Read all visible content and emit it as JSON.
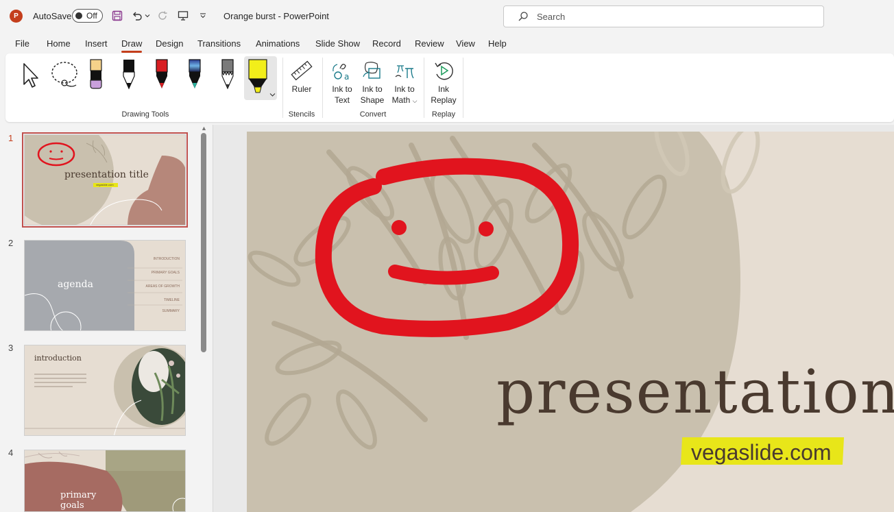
{
  "titlebar": {
    "app_logo": "P",
    "autosave_label": "AutoSave",
    "autosave_state": "Off",
    "doc_title": "Orange burst  -  PowerPoint",
    "search_placeholder": "Search"
  },
  "tabs": [
    "File",
    "Home",
    "Insert",
    "Draw",
    "Design",
    "Transitions",
    "Animations",
    "Slide Show",
    "Record",
    "Review",
    "View",
    "Help"
  ],
  "active_tab": "Draw",
  "ribbon": {
    "groups": {
      "drawing_tools": "Drawing Tools",
      "stencils": "Stencils",
      "convert": "Convert",
      "replay": "Replay"
    },
    "ruler": "Ruler",
    "ink_to_text_1": "Ink to",
    "ink_to_text_2": "Text",
    "ink_to_shape_1": "Ink to",
    "ink_to_shape_2": "Shape",
    "ink_to_math_1": "Ink to",
    "ink_to_math_2": "Math",
    "ink_replay_1": "Ink",
    "ink_replay_2": "Replay"
  },
  "thumbnails": [
    {
      "num": "1",
      "title": "presentation title",
      "sub": "vegaslide.com"
    },
    {
      "num": "2",
      "title": "agenda",
      "items": [
        "INTRODUCTION",
        "PRIMARY GOALS",
        "AREAS OF GROWTH",
        "TIMELINE",
        "SUMMARY"
      ]
    },
    {
      "num": "3",
      "title": "introduction"
    },
    {
      "num": "4",
      "title_1": "primary",
      "title_2": "goals"
    }
  ],
  "slide": {
    "title": "presentation",
    "subtitle": "vegaslide.com"
  },
  "colors": {
    "accent": "#c43e1c",
    "ink_red": "#e1141e",
    "highlight": "#e8e619",
    "slide_bg": "#e6ddd2",
    "slide_circle": "#c9c0ae",
    "text_brown": "#4a3a2f"
  }
}
